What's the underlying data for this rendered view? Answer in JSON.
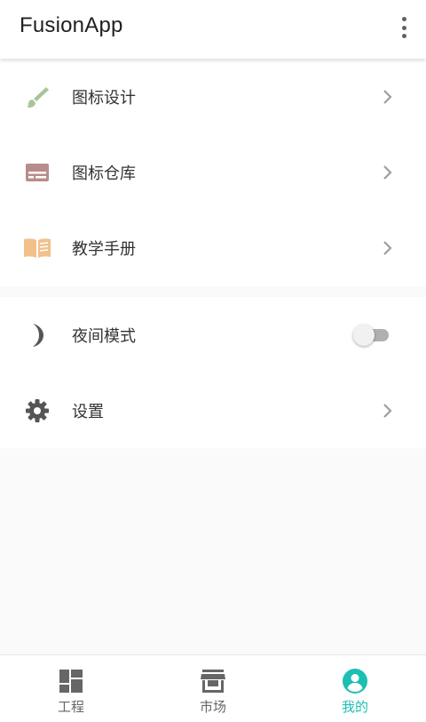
{
  "appbar": {
    "title": "FusionApp",
    "more_icon": "more-vert-icon"
  },
  "menu": {
    "group1": [
      {
        "icon": "paint-brush-icon",
        "label": "图标设计",
        "color": "#a8c49a"
      },
      {
        "icon": "icon-library-icon",
        "label": "图标仓库",
        "color": "#b98c8c"
      },
      {
        "icon": "open-book-icon",
        "label": "教学手册",
        "color": "#f3c08c"
      }
    ],
    "group2": [
      {
        "icon": "moon-icon",
        "label": "夜间模式",
        "toggle": false,
        "color": "#555555"
      },
      {
        "icon": "gear-icon",
        "label": "设置",
        "color": "#555555"
      }
    ]
  },
  "bottom_nav": {
    "items": [
      {
        "icon": "dashboard-icon",
        "label": "工程",
        "active": false
      },
      {
        "icon": "store-icon",
        "label": "市场",
        "active": false
      },
      {
        "icon": "account-circle-icon",
        "label": "我的",
        "active": true
      }
    ],
    "active_color": "#1dbfb2",
    "inactive_color": "#666666"
  }
}
